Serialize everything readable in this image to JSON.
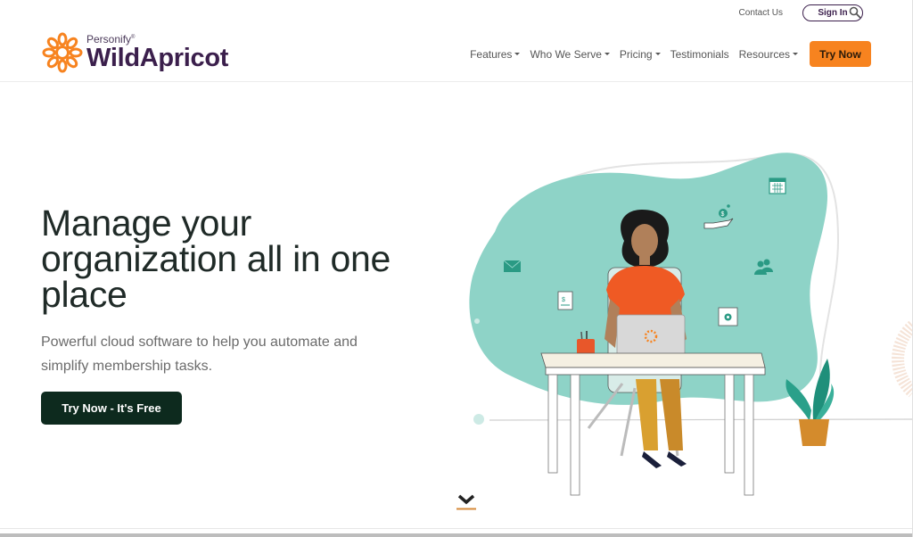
{
  "header": {
    "brand_small": "Personify",
    "brand_small_mark": "®",
    "brand_big": "WildApricot",
    "utility": {
      "contact": "Contact Us",
      "signin": "Sign In",
      "search_icon": "search-icon"
    },
    "nav": [
      {
        "label": "Features",
        "has_dropdown": true
      },
      {
        "label": "Who We Serve",
        "has_dropdown": true
      },
      {
        "label": "Pricing",
        "has_dropdown": true
      },
      {
        "label": "Testimonials",
        "has_dropdown": false
      },
      {
        "label": "Resources",
        "has_dropdown": true
      }
    ],
    "try_now": "Try Now"
  },
  "hero": {
    "title": "Manage your organization all in one place",
    "subtitle": "Powerful cloud software to help you automate and simplify membership tasks.",
    "cta": "Try Now - It's Free"
  },
  "illustration": {
    "icons": [
      "envelope-icon",
      "receipt-icon",
      "donation-hand-icon",
      "calendar-icon",
      "people-icon",
      "settings-window-icon"
    ],
    "description": "Woman working at laptop on desk with plant"
  },
  "colors": {
    "brand_orange": "#f7831f",
    "brand_purple": "#3b1f4c",
    "cta_dark": "#0d2a1e",
    "blob_teal": "#8ed3c7"
  }
}
